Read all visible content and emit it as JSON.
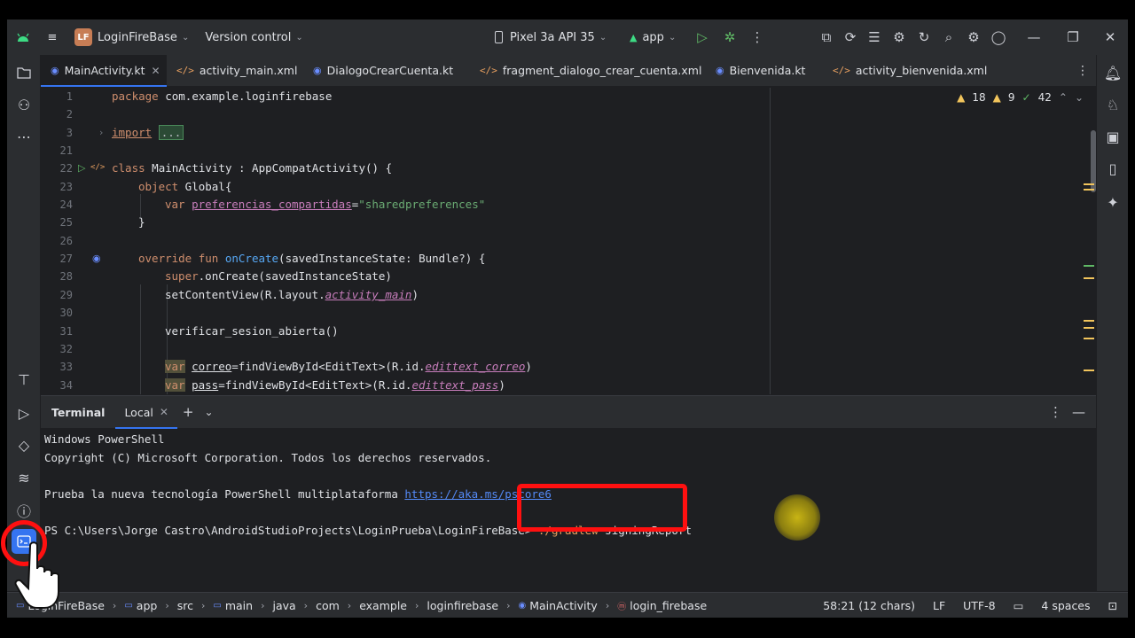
{
  "titlebar": {
    "project_badge": "LF",
    "project_name": "LoginFireBase",
    "version_control": "Version control",
    "device": "Pixel 3a API 35",
    "run_config": "app"
  },
  "tabs": [
    {
      "label": "MainActivity.kt",
      "kind": "kotlin",
      "active": true
    },
    {
      "label": "activity_main.xml",
      "kind": "xml"
    },
    {
      "label": "DialogoCrearCuenta.kt",
      "kind": "kotlin"
    },
    {
      "label": "fragment_dialogo_crear_cuenta.xml",
      "kind": "xml"
    },
    {
      "label": "Bienvenida.kt",
      "kind": "kotlin"
    },
    {
      "label": "activity_bienvenida.xml",
      "kind": "xml"
    }
  ],
  "inspections": {
    "warnings": "18",
    "weak_warnings": "9",
    "ok": "42"
  },
  "editor": {
    "line_numbers": [
      "1",
      "2",
      "3",
      "21",
      "22",
      "23",
      "24",
      "25",
      "26",
      "27",
      "28",
      "29",
      "30",
      "31",
      "32",
      "33",
      "34"
    ],
    "lines": {
      "l1_kw": "package",
      "l1_rest": " com.example.loginfirebase",
      "l3_kw": "import",
      "l3_fold": "...",
      "l22_kw": "class",
      "l22_rest": " MainActivity : AppCompatActivity() {",
      "l23_kw": "object",
      "l23_rest": " Global{",
      "l24_kw": "var",
      "l24_prop": "preferencias_compartidas",
      "l24_eq": "=",
      "l24_str": "\"sharedpreferences\"",
      "l25": "}",
      "l27_kw": "override fun",
      "l27_fn": " onCreate",
      "l27_rest": "(savedInstanceState: Bundle?) {",
      "l28_kw": "super",
      "l28_rest": ".onCreate(savedInstanceState)",
      "l29_a": "setContentView(R.layout.",
      "l29_b": "activity_main",
      "l29_c": ")",
      "l31": "verificar_sesion_abierta()",
      "l33_kw": "var",
      "l33_var": "correo",
      "l33_a": "=findViewById<EditText>(R.id.",
      "l33_b": "edittext_correo",
      "l33_c": ")",
      "l34_kw": "var",
      "l34_var": "pass",
      "l34_a": "=findViewById<EditText>(R.id.",
      "l34_b": "edittext_pass",
      "l34_c": ")"
    }
  },
  "terminal": {
    "title": "Terminal",
    "tab_label": "Local",
    "lines": {
      "l1": "Windows PowerShell",
      "l2": "Copyright (C) Microsoft Corporation. Todos los derechos reservados.",
      "l4_text": "Prueba la nueva tecnología PowerShell multiplataforma ",
      "l4_link": "https://aka.ms/pscore6",
      "prompt": "PS C:\\Users\\Jorge Castro\\AndroidStudioProjects\\LoginPrueba\\LoginFireBase> ",
      "cmd_exe": "./gradlew",
      "cmd_args": " signingReport"
    }
  },
  "statusbar": {
    "breadcrumbs": [
      "LoginFireBase",
      "app",
      "src",
      "main",
      "java",
      "com",
      "example",
      "loginfirebase",
      "MainActivity",
      "login_firebase"
    ],
    "cursor_pos": "58:21 (12 chars)",
    "line_sep": "LF",
    "encoding": "UTF-8",
    "indent": "4 spaces"
  },
  "colors": {
    "accent": "#3574f0",
    "highlight": "#ff1010",
    "keyword": "#cf8e6d",
    "string": "#6aab73"
  }
}
